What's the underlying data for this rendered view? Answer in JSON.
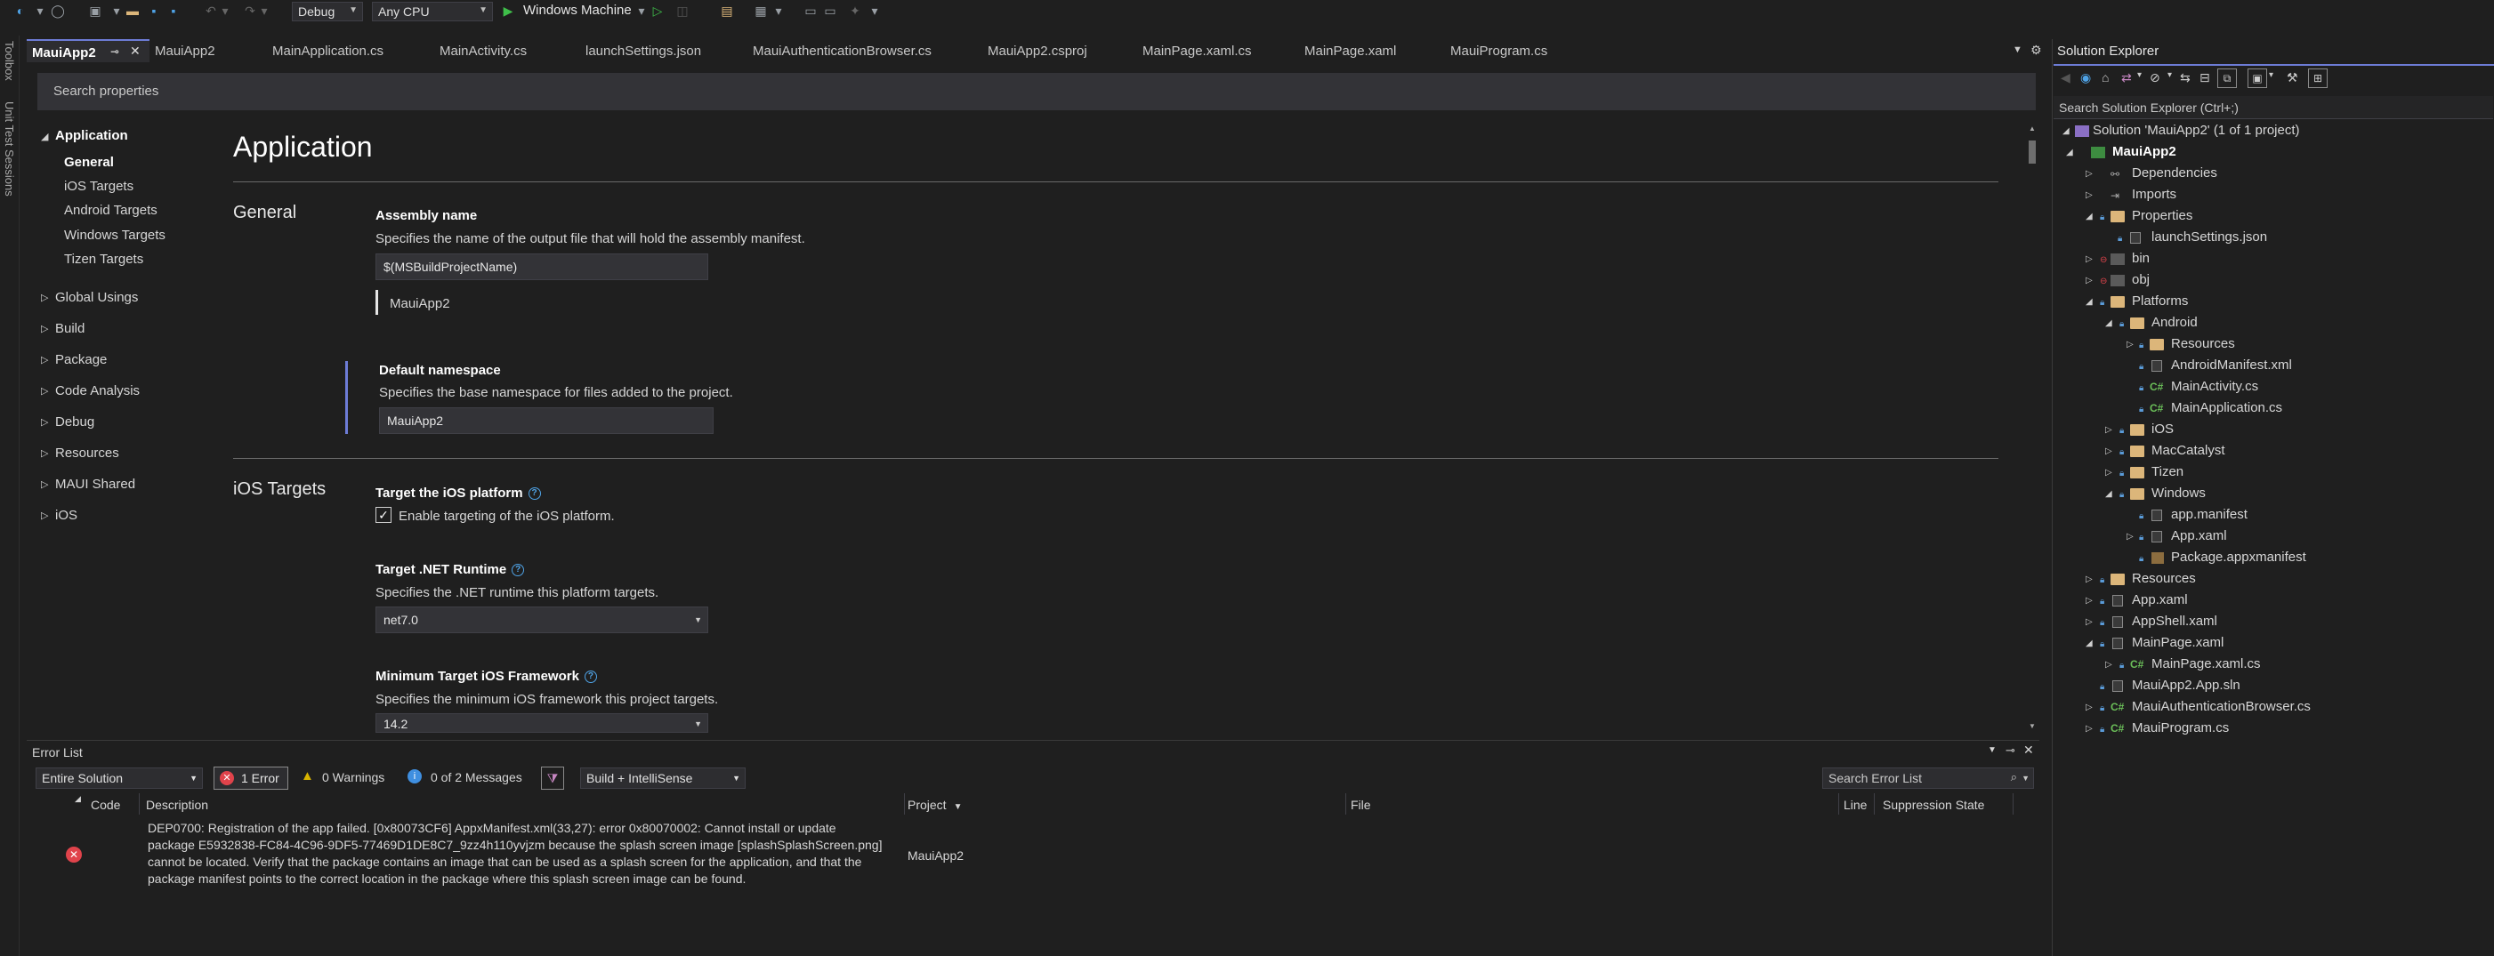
{
  "toolbar": {
    "config": "Debug",
    "platform": "Any CPU",
    "run_target": "Windows Machine"
  },
  "left_strip": {
    "toolbox": "Toolbox",
    "unit_test": "Unit Test Sessions"
  },
  "tabs": [
    {
      "label": "MauiApp2"
    },
    {
      "label": "MauiApp2"
    },
    {
      "label": "MainApplication.cs"
    },
    {
      "label": "MainActivity.cs"
    },
    {
      "label": "launchSettings.json"
    },
    {
      "label": "MauiAuthenticationBrowser.cs"
    },
    {
      "label": "MauiApp2.csproj"
    },
    {
      "label": "MainPage.xaml.cs"
    },
    {
      "label": "MainPage.xaml"
    },
    {
      "label": "MauiProgram.cs"
    }
  ],
  "props": {
    "search_placeholder": "Search properties",
    "nav": {
      "application": "Application",
      "general": "General",
      "ios_targets": "iOS Targets",
      "android_targets": "Android Targets",
      "windows_targets": "Windows Targets",
      "tizen_targets": "Tizen Targets",
      "global_usings": "Global Usings",
      "build": "Build",
      "package": "Package",
      "code_analysis": "Code Analysis",
      "debug": "Debug",
      "resources": "Resources",
      "maui_shared": "MAUI Shared",
      "ios": "iOS"
    },
    "page_title": "Application",
    "general_header": "General",
    "assembly_name_label": "Assembly name",
    "assembly_name_desc": "Specifies the name of the output file that will hold the assembly manifest.",
    "assembly_name_value": "$(MSBuildProjectName)",
    "assembly_name_eval": "MauiApp2",
    "default_ns_label": "Default namespace",
    "default_ns_desc": "Specifies the base namespace for files added to the project.",
    "default_ns_value": "MauiApp2",
    "ios_header": "iOS Targets",
    "target_ios_label": "Target the iOS platform",
    "target_ios_checkbox": "Enable targeting of the iOS platform.",
    "runtime_label": "Target .NET Runtime",
    "runtime_desc": "Specifies the .NET runtime this platform targets.",
    "runtime_value": "net7.0",
    "min_ios_label": "Minimum Target iOS Framework",
    "min_ios_desc": "Specifies the minimum iOS framework this project targets.",
    "min_ios_value": "14.2"
  },
  "error_list": {
    "title": "Error List",
    "scope": "Entire Solution",
    "errors": "1 Error",
    "warnings": "0 Warnings",
    "messages": "0 of 2 Messages",
    "build_filter": "Build + IntelliSense",
    "search_placeholder": "Search Error List",
    "columns": {
      "code": "Code",
      "description": "Description",
      "project": "Project",
      "file": "File",
      "line": "Line",
      "suppression": "Suppression State"
    },
    "rows": [
      {
        "code": "",
        "description_lines": [
          "DEP0700: Registration of the app failed. [0x80073CF6] AppxManifest.xml(33,27): error 0x80070002: Cannot install or update",
          "package E5932838-FC84-4C96-9DF5-77469D1DE8C7_9zz4h110yvjzm because the splash screen image [splashSplashScreen.png]",
          "cannot be located. Verify that the package contains an image that can be used as a splash screen for the application, and that the",
          "package manifest points to the correct location in the package where this splash screen image can be found."
        ],
        "project": "MauiApp2"
      }
    ]
  },
  "solution_explorer": {
    "title": "Solution Explorer",
    "search_placeholder": "Search Solution Explorer (Ctrl+;)",
    "items": [
      {
        "label": "Solution 'MauiApp2' (1 of 1 project)"
      },
      {
        "label": "MauiApp2"
      },
      {
        "label": "Dependencies"
      },
      {
        "label": "Imports"
      },
      {
        "label": "Properties"
      },
      {
        "label": "launchSettings.json"
      },
      {
        "label": "bin"
      },
      {
        "label": "obj"
      },
      {
        "label": "Platforms"
      },
      {
        "label": "Android"
      },
      {
        "label": "Resources"
      },
      {
        "label": "AndroidManifest.xml"
      },
      {
        "label": "MainActivity.cs"
      },
      {
        "label": "MainApplication.cs"
      },
      {
        "label": "iOS"
      },
      {
        "label": "MacCatalyst"
      },
      {
        "label": "Tizen"
      },
      {
        "label": "Windows"
      },
      {
        "label": "app.manifest"
      },
      {
        "label": "App.xaml"
      },
      {
        "label": "Package.appxmanifest"
      },
      {
        "label": "Resources"
      },
      {
        "label": "App.xaml"
      },
      {
        "label": "AppShell.xaml"
      },
      {
        "label": "MainPage.xaml"
      },
      {
        "label": "MainPage.xaml.cs"
      },
      {
        "label": "MauiApp2.App.sln"
      },
      {
        "label": "MauiAuthenticationBrowser.cs"
      },
      {
        "label": "MauiProgram.cs"
      }
    ]
  },
  "colors": {
    "accent": "#6d7cd6",
    "error_red": "#e0434b",
    "warning_yellow": "#d8b400",
    "info_blue": "#3f8fe0",
    "run_green": "#3fbf4a"
  }
}
